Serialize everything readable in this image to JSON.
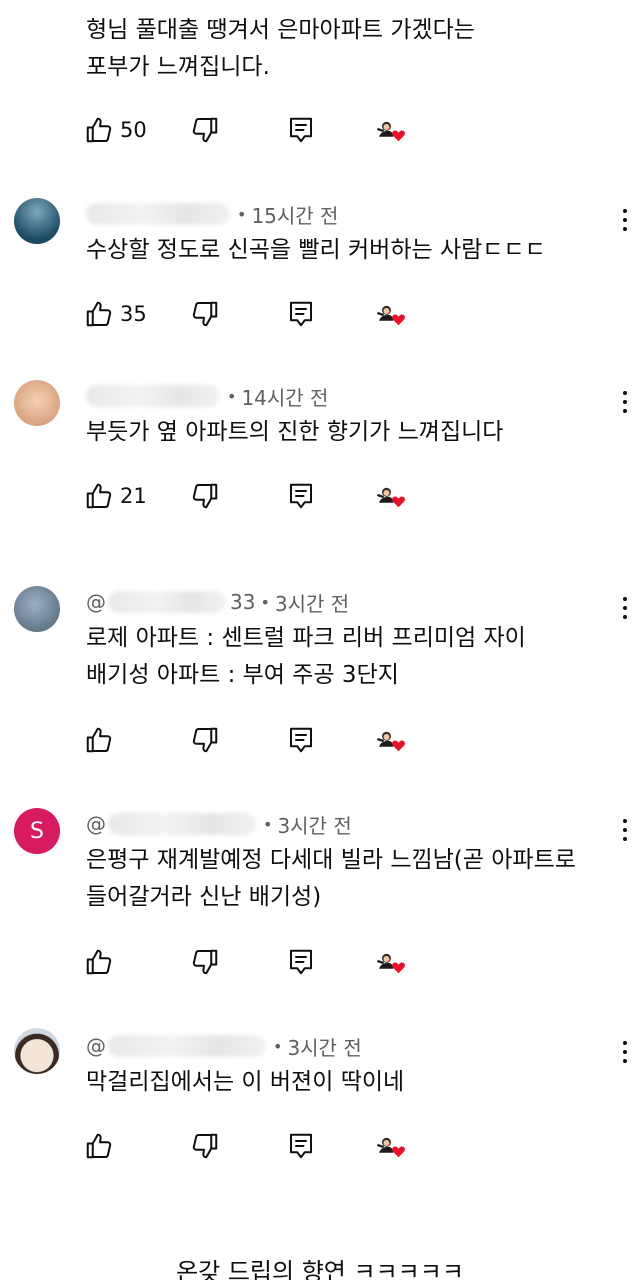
{
  "comments": [
    {
      "text_lines": [
        "형님 풀대출 땡겨서 은마아파트 가겠다는",
        "포부가 느껴집니다."
      ],
      "likes": "50"
    },
    {
      "handle_prefix": "",
      "handle_suffix": "",
      "time": "15시간 전",
      "text_lines": [
        "수상할 정도로 신곡을 빨리 커버하는 사람ㄷㄷㄷ"
      ],
      "likes": "35",
      "avatar_colors": [
        "#1b4a63",
        "#7da9bd"
      ]
    },
    {
      "handle_prefix": "",
      "handle_suffix": "",
      "time": "14시간 전",
      "text_lines": [
        "부듯가 옆 아파트의 진한 향기가 느껴집니다"
      ],
      "likes": "21",
      "avatar_colors": [
        "#f0c8a8",
        "#c89070"
      ]
    },
    {
      "handle_prefix": "@",
      "handle_suffix": "33",
      "time": "3시간 전",
      "text_lines": [
        "로제 아파트 : 센트럴 파크 리버 프리미엄 자이",
        "배기성 아파트 : 부여 주공 3단지"
      ],
      "likes": "",
      "avatar_colors": [
        "#5f7487",
        "#9bb0c2"
      ]
    },
    {
      "handle_prefix": "@",
      "handle_suffix": "",
      "time": "3시간 전",
      "text_lines": [
        "은평구 재계발예정 다세대 빌라 느낌남(곧 아파트로",
        "들어갈거라 신난 배기성)"
      ],
      "likes": "",
      "avatar_letter": "S",
      "avatar_colors": [
        "#d81b60",
        "#d81b60"
      ]
    },
    {
      "handle_prefix": "@",
      "handle_suffix": "",
      "time": "3시간 전",
      "text_lines": [
        "막걸리집에서는 이 버젼이 딱이네"
      ],
      "likes": "",
      "avatar_colors": [
        "#f3e6d8",
        "#3a2a22"
      ]
    }
  ],
  "icons": {
    "like": "thumbs-up-icon",
    "dislike": "thumbs-down-icon",
    "reply": "reply-icon",
    "more": "more-vert-icon",
    "creator_heart": "creator-heart-icon"
  },
  "colors": {
    "heart": "#e8132b",
    "text": "#0f0f0f",
    "meta": "#606060"
  },
  "caption": "온갖 드립의 향연 ㅋㅋㅋㅋㅋ"
}
